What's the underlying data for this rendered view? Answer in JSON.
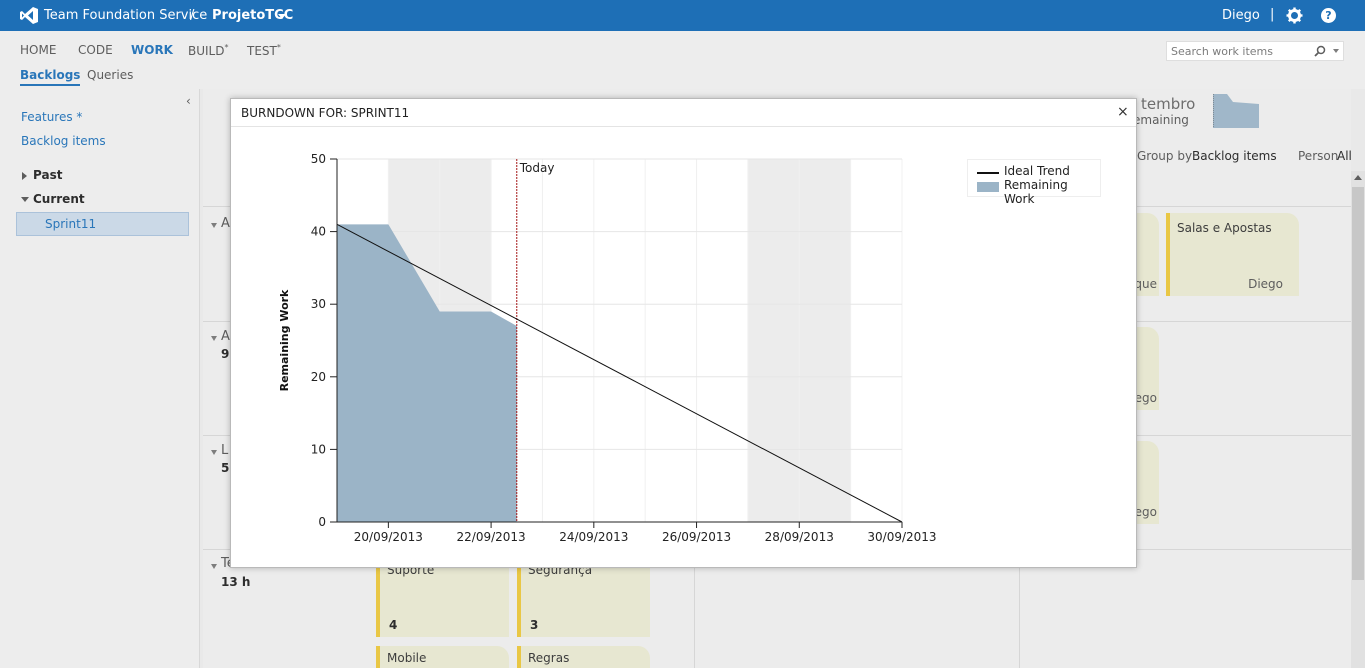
{
  "topbar": {
    "brand": "Team Foundation Service",
    "separator": "/",
    "project": "ProjetoTCC",
    "user": "Diego",
    "divider": "|",
    "help": "?"
  },
  "nav": {
    "tabs": [
      {
        "label": "HOME"
      },
      {
        "label": "CODE"
      },
      {
        "label": "WORK"
      },
      {
        "label": "BUILD",
        "sup": "*"
      },
      {
        "label": "TEST",
        "sup": "*"
      }
    ],
    "subtabs": [
      {
        "label": "Backlogs"
      },
      {
        "label": "Queries"
      }
    ],
    "search_placeholder": "Search work items"
  },
  "sidebar": {
    "features": "Features *",
    "backlog": "Backlog items",
    "past": "Past",
    "current": "Current",
    "sprint": "Sprint11"
  },
  "board": {
    "header": {
      "date_fragment": "tembro",
      "remaining_fragment": "emaining",
      "group_by_label": "Group by",
      "group_by_value": "Backlog items",
      "person_label": "Person",
      "person_value": "All"
    },
    "rows": [
      {
        "label": "A",
        "count": ""
      },
      {
        "label": "A",
        "count": "9"
      },
      {
        "label": "L",
        "count": "5"
      },
      {
        "label": "Teste do sistema",
        "count": "13 h"
      }
    ],
    "cards": [
      {
        "title": "Salas e Apostas",
        "owner": "Diego"
      },
      {
        "title": "",
        "owner": "que"
      },
      {
        "title": "",
        "owner": "ego"
      },
      {
        "title": "",
        "owner": "ego"
      },
      {
        "title": "Suporte",
        "num": "4"
      },
      {
        "title": "Segurança",
        "num": "3"
      },
      {
        "title": "Mobile"
      },
      {
        "title": "Regras"
      }
    ]
  },
  "dialog": {
    "title": "BURNDOWN FOR: SPRINT11",
    "close": "×"
  },
  "chart_data": {
    "type": "area",
    "title": "",
    "ylabel": "Remaining Work",
    "xlabel": "",
    "ylim": [
      0,
      50
    ],
    "yticks": [
      "0",
      "10",
      "20",
      "30",
      "40",
      "50"
    ],
    "x": [
      "19/09/2013",
      "20/09/2013",
      "21/09/2013",
      "22/09/2013",
      "23/09/2013",
      "24/09/2013",
      "25/09/2013",
      "26/09/2013",
      "27/09/2013",
      "28/09/2013",
      "29/09/2013",
      "30/09/2013"
    ],
    "xtick_labels": [
      "20/09/2013",
      "22/09/2013",
      "24/09/2013",
      "26/09/2013",
      "28/09/2013",
      "30/09/2013"
    ],
    "today_label": "Today",
    "today_x": "22.5/09/2013",
    "weekend_bands": [
      [
        "20/09/2013",
        "22/09/2013"
      ],
      [
        "27/09/2013",
        "29/09/2013"
      ]
    ],
    "grid": true,
    "legend_position": "top-right",
    "series": [
      {
        "name": "Ideal Trend",
        "kind": "line",
        "color": "#111111",
        "points": [
          [
            "19/09/2013",
            41
          ],
          [
            "30/09/2013",
            0
          ]
        ]
      },
      {
        "name": "Remaining Work",
        "kind": "area",
        "color": "#9bb4c7",
        "points": [
          [
            "19/09/2013",
            41
          ],
          [
            "20/09/2013",
            41
          ],
          [
            "21/09/2013",
            29
          ],
          [
            "22/09/2013",
            29
          ],
          [
            "22.5/09/2013",
            27
          ]
        ]
      }
    ]
  }
}
